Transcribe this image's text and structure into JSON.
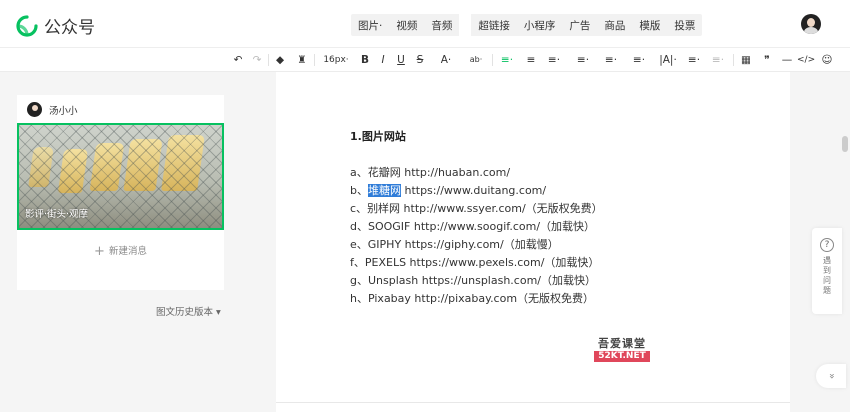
{
  "app": {
    "name": "公众号",
    "brand_color": "#07c160"
  },
  "top_menu": {
    "group1": [
      "图片·",
      "视频",
      "音频"
    ],
    "group2": [
      "超链接",
      "小程序",
      "广告",
      "商品",
      "模版",
      "投票"
    ]
  },
  "toolbar": {
    "font_size": "16px·",
    "items": [
      "↶",
      "↷",
      "◆",
      "♜",
      "B",
      "I",
      "U",
      "S",
      "A·",
      "ab·",
      "≡·",
      "≡",
      "≡·",
      "≡·",
      "≡·",
      "≡·",
      "|A|·",
      "≡·",
      "≡·",
      "▦",
      "❞",
      "—",
      "</>",
      "☺"
    ]
  },
  "left_panel": {
    "author": "汤小小",
    "thumbnail_caption": "影评·街头·观摩",
    "new_message": "新建消息",
    "history": "图文历史版本 ▾"
  },
  "editor": {
    "heading": "1.图片网站",
    "lines": [
      {
        "prefix": "a、",
        "highlight": "",
        "text": "花瓣网 http://huaban.com/"
      },
      {
        "prefix": "b、",
        "highlight": "堆糖网",
        "text": " https://www.duitang.com/"
      },
      {
        "prefix": "c、",
        "highlight": "",
        "text": "别样网 http://www.ssyer.com/（无版权免费）"
      },
      {
        "prefix": "d、",
        "highlight": "",
        "text": "SOOGIF http://www.soogif.com/（加载快）"
      },
      {
        "prefix": "e、",
        "highlight": "",
        "text": "GIPHY https://giphy.com/（加载慢）"
      },
      {
        "prefix": "f、",
        "highlight": "",
        "text": "PEXELS https://www.pexels.com/（加载快）"
      },
      {
        "prefix": "g、",
        "highlight": "",
        "text": "Unsplash https://unsplash.com/（加载快）"
      },
      {
        "prefix": "h、",
        "highlight": "",
        "text": "Pixabay http://pixabay.com（无版权免费）"
      }
    ],
    "watermark": {
      "line1": "吾爱课堂",
      "line2": "52KT.NET"
    }
  },
  "right_side": {
    "help_label": "遇到问题",
    "help_icon": "?",
    "collapse_icon": "»"
  }
}
